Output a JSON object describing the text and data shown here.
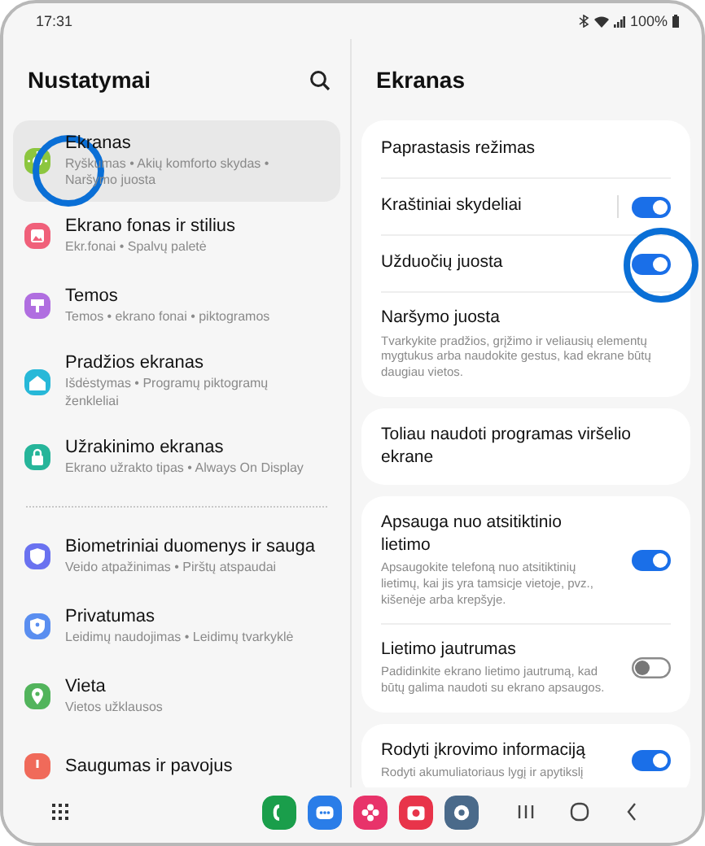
{
  "status_bar": {
    "time": "17:31",
    "battery": "100%"
  },
  "settings": {
    "title": "Nustatymai",
    "sections": [
      {
        "items": [
          {
            "label": "Ekranas",
            "desc": "Ryškumas • Akių komforto skydas • Naršymo juosta",
            "color": "#8cc63f",
            "selected": true
          },
          {
            "label": "Ekrano fonas ir stilius",
            "desc": "Ekr.fonai • Spalvų paletė",
            "color": "#f0607a",
            "selected": false
          },
          {
            "label": "Temos",
            "desc": "Temos • ekrano fonai • piktogramos",
            "color": "#b06ee0",
            "selected": false
          },
          {
            "label": "Pradžios ekranas",
            "desc": "Išdėstymas • Programų piktogramų ženkleliai",
            "color": "#27b8d8",
            "selected": false
          },
          {
            "label": "Užrakinimo ekranas",
            "desc": "Ekrano užrakto tipas • Always On Display",
            "color": "#26b59a",
            "selected": false
          }
        ]
      },
      {
        "items": [
          {
            "label": "Biometriniai duomenys ir sauga",
            "desc": "Veido atpažinimas • Pirštų atspaudai",
            "color": "#6a72f0",
            "selected": false
          },
          {
            "label": "Privatumas",
            "desc": "Leidimų naudojimas • Leidimų tvarkyklė",
            "color": "#5a8ef0",
            "selected": false
          },
          {
            "label": "Vieta",
            "desc": "Vietos užklausos",
            "color": "#52b45c",
            "selected": false
          },
          {
            "label": "Saugumas ir pavojus",
            "color": "#f06a5a",
            "selected": false
          }
        ]
      }
    ]
  },
  "detail": {
    "title": "Ekranas",
    "cards": [
      {
        "rows": [
          {
            "kind": "plain",
            "label": "Paprastasis režimas"
          },
          {
            "kind": "split-toggle",
            "label": "Kraštiniai skydeliai",
            "on": true
          },
          {
            "kind": "toggle",
            "label": "Užduočių juosta",
            "on": true
          },
          {
            "kind": "plain",
            "label": "Naršymo juosta",
            "desc": "Tvarkykite pradžios, grįžimo ir veliausių elementų mygtukus arba naudokite gestus, kad ekrane būtų daugiau vietos."
          }
        ]
      },
      {
        "rows": [
          {
            "kind": "plain",
            "label": "Toliau naudoti programas viršelio ekrane"
          }
        ]
      },
      {
        "rows": [
          {
            "kind": "toggle",
            "label": "Apsauga nuo atsitiktinio lietimo",
            "desc": "Apsaugokite telefoną nuo atsitiktinių lietimų, kai jis yra tamsicje vietoje, pvz., kišenėje arba krepšyje.",
            "on": true
          },
          {
            "kind": "toggle",
            "label": "Lietimo jautrumas",
            "desc": "Padidinkite ekrano lietimo jautrumą, kad būtų galima naudoti su ekrano apsaugos.",
            "on": false
          }
        ]
      },
      {
        "rows": [
          {
            "kind": "toggle",
            "label": "Rodyti įkrovimo informaciją",
            "desc": "Rodyti akumuliatoriaus lygį ir apytikslį",
            "on": true
          }
        ]
      }
    ]
  },
  "dock": {
    "apps": [
      {
        "color": "#1a9e4b"
      },
      {
        "color": "#2a7de8"
      },
      {
        "color": "#e8336a"
      },
      {
        "color": "#e8344a"
      },
      {
        "color": "#4a6a8a"
      }
    ]
  }
}
